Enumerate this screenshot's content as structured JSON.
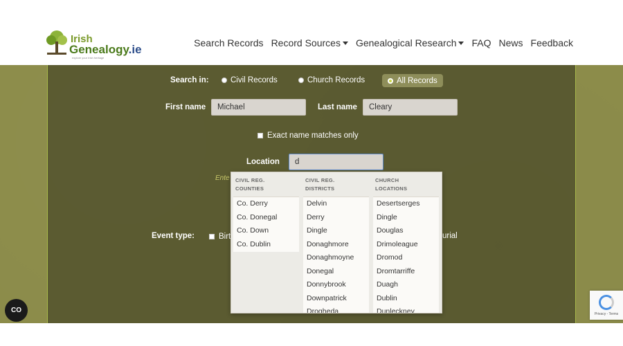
{
  "header": {
    "logo": {
      "line1": "Irish",
      "line2": "Genealogy",
      "suffix": ".ie",
      "tagline": "explore your Irish heritage"
    },
    "nav": [
      {
        "label": "Search Records",
        "dropdown": false
      },
      {
        "label": "Record Sources",
        "dropdown": true
      },
      {
        "label": "Genealogical Research",
        "dropdown": true
      },
      {
        "label": "FAQ",
        "dropdown": false
      },
      {
        "label": "News",
        "dropdown": false
      },
      {
        "label": "Feedback",
        "dropdown": false
      }
    ]
  },
  "search": {
    "search_in_label": "Search in:",
    "options": [
      {
        "label": "Civil Records",
        "selected": false
      },
      {
        "label": "Church Records",
        "selected": false
      },
      {
        "label": "All Records",
        "selected": true
      }
    ],
    "first_name_label": "First name",
    "first_name_value": "Michael",
    "last_name_label": "Last name",
    "last_name_value": "Cleary",
    "exact_label": "Exact name matches only",
    "location_label": "Location",
    "location_value": "d",
    "hint_partial": "Ente",
    "event_type_label": "Event type:",
    "event_birth_partial": "Birt",
    "event_burial_partial": "urial"
  },
  "dropdown": {
    "columns": [
      {
        "heading": "CIVIL REG. COUNTIES",
        "items": [
          "Co. Derry",
          "Co. Donegal",
          "Co. Down",
          "Co. Dublin"
        ]
      },
      {
        "heading": "CIVIL REG. DISTRICTS",
        "items": [
          "Delvin",
          "Derry",
          "Dingle",
          "Donaghmore",
          "Donaghmoyne",
          "Donegal",
          "Donnybrook",
          "Downpatrick",
          "Drogheda"
        ]
      },
      {
        "heading": "CHURCH LOCATIONS",
        "items": [
          "Desertserges",
          "Dingle",
          "Douglas",
          "Drimoleague",
          "Dromod",
          "Dromtarriffe",
          "Duagh",
          "Dublin",
          "Dunleckney"
        ]
      }
    ]
  },
  "widgets": {
    "accessibility_label": "CO",
    "recaptcha_text": "Privacy - Terms"
  },
  "colors": {
    "accent": "#c9d84a",
    "panel": "#58582f",
    "focus": "#5b86c8"
  }
}
